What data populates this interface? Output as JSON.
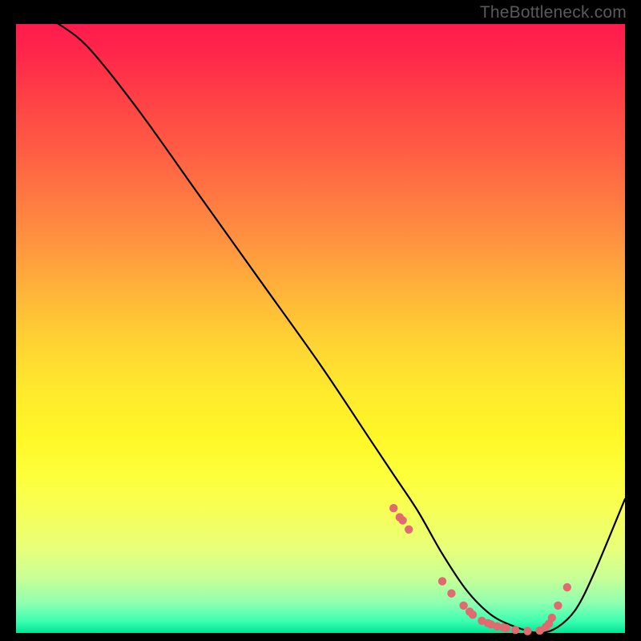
{
  "watermark": "TheBottleneck.com",
  "chart_data": {
    "type": "line",
    "title": "",
    "xlabel": "",
    "ylabel": "",
    "xlim": [
      0,
      100
    ],
    "ylim": [
      0,
      100
    ],
    "series": [
      {
        "name": "bottleneck-curve",
        "x": [
          0,
          3,
          7,
          12,
          20,
          30,
          40,
          50,
          58,
          62,
          66,
          70,
          74,
          78,
          82,
          86,
          89,
          92,
          95,
          100
        ],
        "y": [
          104,
          102,
          100,
          96,
          86,
          72,
          58,
          44,
          32,
          26,
          20,
          13,
          7,
          3,
          1,
          0,
          1,
          4,
          10,
          22
        ]
      }
    ],
    "markers": {
      "name": "highlight-points",
      "color": "#e06a6f",
      "x": [
        62,
        63,
        63.5,
        64.5,
        70,
        71.5,
        73.5,
        74.5,
        75,
        76.5,
        77.5,
        78,
        79,
        80,
        80.5,
        82,
        84,
        86,
        87,
        87.5,
        88,
        89,
        90.5
      ],
      "y": [
        20.5,
        19,
        18.5,
        17,
        8.5,
        6.5,
        4.5,
        3.5,
        3,
        2,
        1.6,
        1.4,
        1.1,
        0.9,
        0.8,
        0.5,
        0.3,
        0.4,
        1,
        1.5,
        2.5,
        4.5,
        7.5
      ]
    }
  }
}
